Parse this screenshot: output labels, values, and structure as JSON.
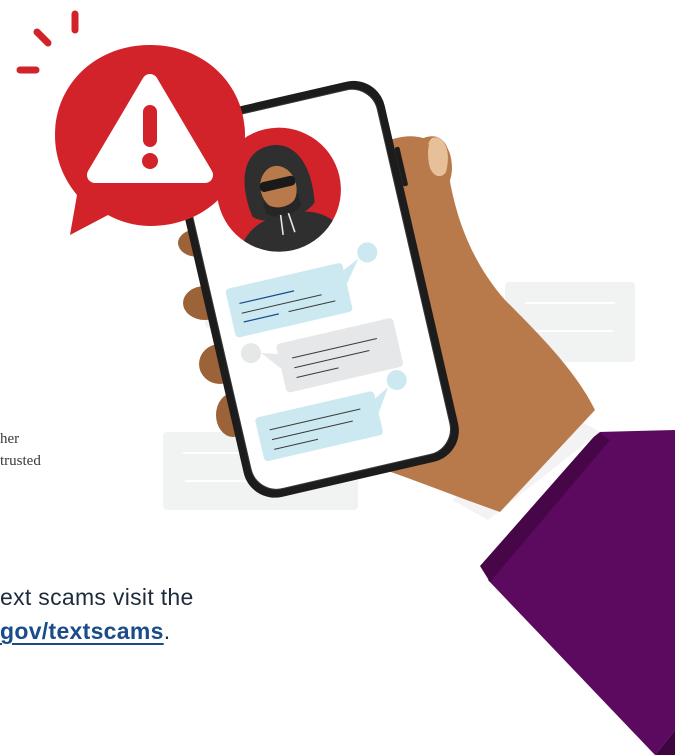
{
  "text": {
    "partial_line_1": "her",
    "partial_line_2": "trusted",
    "cta_line_1": "ext scams visit the",
    "cta_link": "gov/textscams",
    "cta_period": "."
  },
  "colors": {
    "alert_red": "#d2232a",
    "hoodie_dark": "#2f2f2f",
    "skin": "#b97a4b",
    "sleeve_purple": "#5b0a5f",
    "bubble_blue": "#cce9f1",
    "bubble_grey": "#e6e7e8",
    "link_blue": "#1a4c8b"
  },
  "icons": [
    "warning-triangle-icon",
    "scammer-avatar-icon"
  ]
}
